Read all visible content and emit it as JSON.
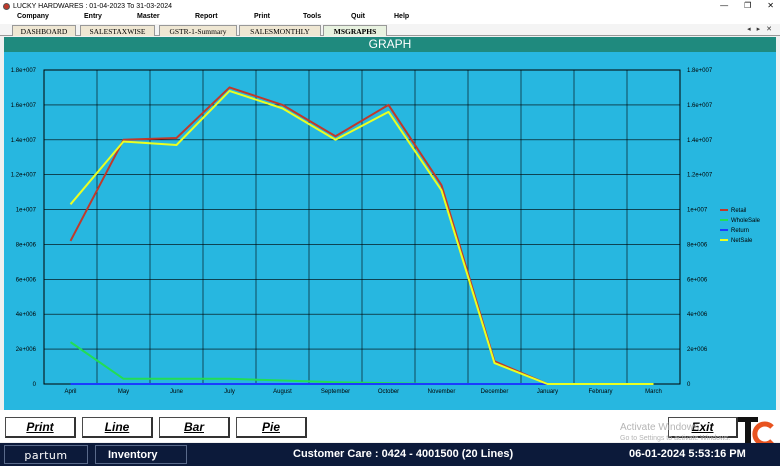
{
  "window": {
    "title": "LUCKY HARDWARES  :  01-04-2023 To 31-03-2024",
    "controls": [
      "—",
      "❐",
      "✕"
    ]
  },
  "menu": [
    "Company",
    "Entry",
    "Master",
    "Report",
    "Print",
    "Tools",
    "Quit",
    "Help"
  ],
  "tabs": [
    "DASHBOARD",
    "SALESTAXWISE",
    "GSTR-1-Summary",
    "SALESMONTHLY",
    "MSGRAPHS"
  ],
  "active_tab": "MSGRAPHS",
  "tab_arrows": [
    "◂",
    "▸",
    "✕"
  ],
  "graph_header": "GRAPH",
  "chart_data": {
    "type": "line",
    "categories": [
      "April",
      "May",
      "June",
      "July",
      "August",
      "September",
      "October",
      "November",
      "December",
      "January",
      "February",
      "March"
    ],
    "ylim": [
      0,
      18000000
    ],
    "y_ticks": [
      "0",
      "2e+006",
      "4e+006",
      "6e+006",
      "8e+006",
      "1e+007",
      "1.2e+007",
      "1.4e+007",
      "1.6e+007",
      "1.8e+007"
    ],
    "grid": true,
    "legend_position": "right",
    "series": [
      {
        "name": "Retail",
        "color": "#c0392b",
        "values": [
          8200000,
          14000000,
          14100000,
          17000000,
          16000000,
          14200000,
          16000000,
          11400000,
          1300000,
          0,
          0,
          0
        ]
      },
      {
        "name": "WholeSale",
        "color": "#22dd55",
        "values": [
          2400000,
          300000,
          300000,
          300000,
          200000,
          100000,
          50000,
          0,
          0,
          0,
          0,
          0
        ]
      },
      {
        "name": "Return",
        "color": "#1a3cff",
        "values": [
          0,
          0,
          0,
          0,
          0,
          0,
          0,
          0,
          0,
          0,
          0,
          0
        ]
      },
      {
        "name": "NetSale",
        "color": "#eaff22",
        "values": [
          10300000,
          13900000,
          13700000,
          16800000,
          15800000,
          14000000,
          15600000,
          11100000,
          1200000,
          0,
          0,
          0
        ]
      }
    ]
  },
  "buttons": {
    "print": "Print",
    "line": "Line",
    "bar": "Bar",
    "pie": "Pie",
    "exit": "Exit"
  },
  "watermark": {
    "line1": "Activate Windows",
    "line2": "Go to Settings to activate Windows."
  },
  "status": {
    "brand": "partum",
    "module": "Inventory",
    "customer_care": "Customer Care : 0424 - 4001500  (20 Lines)",
    "datetime": "06-01-2024 5:53:16 PM"
  }
}
